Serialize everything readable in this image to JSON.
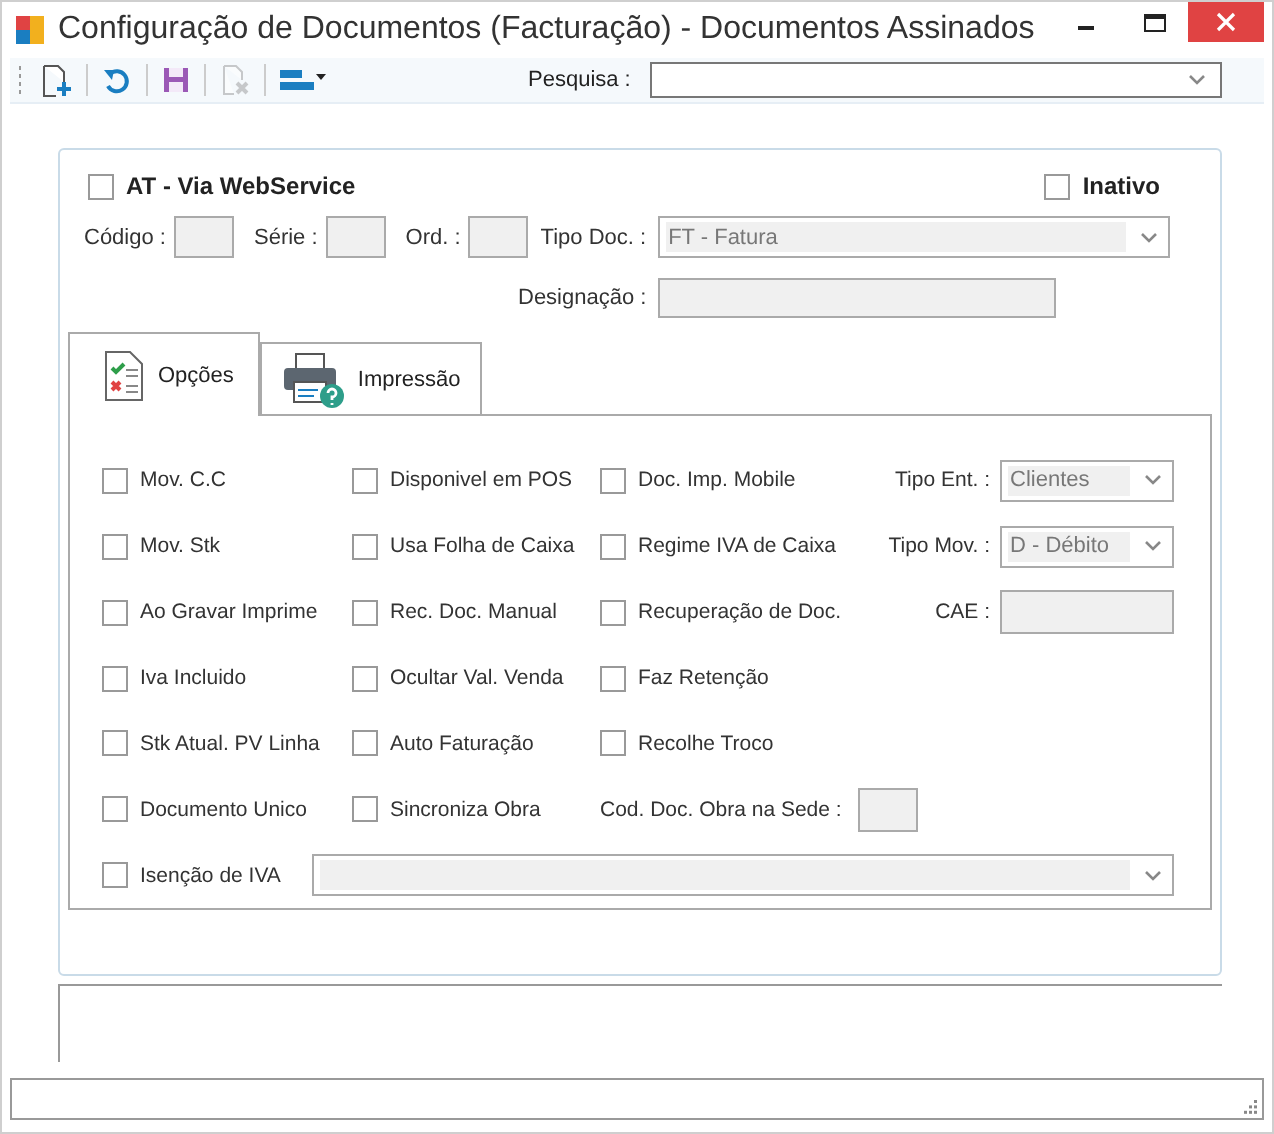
{
  "window": {
    "title": "Configuração de Documentos (Facturação) - Documentos Assinados"
  },
  "toolbar": {
    "buttons": [
      {
        "kind": "new",
        "disabled": false
      },
      {
        "kind": "refresh",
        "disabled": false
      },
      {
        "kind": "save",
        "disabled": false
      },
      {
        "kind": "delete",
        "disabled": true
      },
      {
        "kind": "layout",
        "disabled": false
      }
    ],
    "search": {
      "label": "Pesquisa :"
    }
  },
  "header": {
    "at_webservice": {
      "label": "AT - Via WebService",
      "checked": false
    },
    "inativo": {
      "label": "Inativo",
      "checked": false
    },
    "fields": [
      {
        "label": "Código :"
      },
      {
        "label": "Série :"
      },
      {
        "label": "Ord. :"
      }
    ],
    "tipo_doc": {
      "label": "Tipo Doc. :",
      "value": "FT - Fatura"
    },
    "designacao": {
      "label": "Designação :"
    }
  },
  "tabs": [
    {
      "kind": "options",
      "label": "Opções",
      "selected": true
    },
    {
      "kind": "print",
      "label": "Impressão",
      "selected": false
    }
  ],
  "options": [
    [
      {
        "kind": "checkbox",
        "label": "Mov. C.C",
        "checked": false
      },
      {
        "kind": "checkbox",
        "label": "Disponivel em POS",
        "checked": false
      },
      {
        "kind": "checkbox",
        "label": "Doc. Imp. Mobile",
        "checked": false
      },
      {
        "kind": "select",
        "label": "Tipo Ent. :",
        "value": "Clientes"
      }
    ],
    [
      {
        "kind": "checkbox",
        "label": "Mov. Stk",
        "checked": false
      },
      {
        "kind": "checkbox",
        "label": "Usa Folha de Caixa",
        "checked": false
      },
      {
        "kind": "checkbox",
        "label": "Regime IVA de Caixa",
        "checked": false
      },
      {
        "kind": "select",
        "label": "Tipo Mov. :",
        "value": "D - Débito"
      }
    ],
    [
      {
        "kind": "checkbox",
        "label": "Ao Gravar Imprime",
        "checked": false
      },
      {
        "kind": "checkbox",
        "label": "Rec. Doc. Manual",
        "checked": false
      },
      {
        "kind": "checkbox",
        "label": "Recuperação de Doc.",
        "checked": false
      },
      {
        "kind": "field",
        "label": "CAE :"
      }
    ],
    [
      {
        "kind": "checkbox",
        "label": "Iva Incluido",
        "checked": false
      },
      {
        "kind": "checkbox",
        "label": "Ocultar Val. Venda",
        "checked": false
      },
      {
        "kind": "checkbox",
        "label": "Faz Retenção",
        "checked": false
      }
    ],
    [
      {
        "kind": "checkbox",
        "label": "Stk Atual. PV Linha",
        "checked": false
      },
      {
        "kind": "checkbox",
        "label": "Auto Faturação",
        "checked": false
      },
      {
        "kind": "checkbox",
        "label": "Recolhe Troco",
        "checked": false
      }
    ],
    [
      {
        "kind": "checkbox",
        "label": "Documento Unico",
        "checked": false
      },
      {
        "kind": "checkbox",
        "label": "Sincroniza Obra",
        "checked": false
      },
      {
        "kind": "small-field",
        "label": "Cod. Doc. Obra na Sede :"
      }
    ],
    [
      {
        "kind": "checkbox",
        "label": "Isenção de IVA",
        "checked": false
      },
      {
        "kind": "wide-select"
      }
    ]
  ]
}
